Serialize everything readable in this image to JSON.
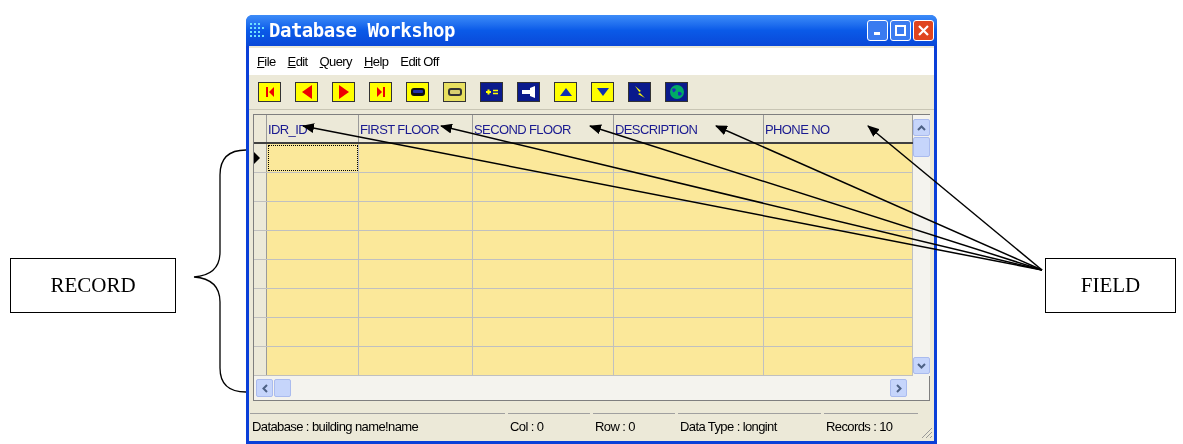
{
  "window": {
    "title": "Database Workshop"
  },
  "menu": [
    {
      "label": "File",
      "mnemonic": true
    },
    {
      "label": "Edit",
      "mnemonic": true
    },
    {
      "label": "Query",
      "mnemonic": true
    },
    {
      "label": "Help",
      "mnemonic": true
    },
    {
      "label": "Edit Off",
      "mnemonic": false
    }
  ],
  "toolbar": [
    {
      "kind": "first"
    },
    {
      "kind": "prev"
    },
    {
      "kind": "next"
    },
    {
      "kind": "last"
    },
    {
      "kind": "goggles-dark"
    },
    {
      "kind": "goggles-light"
    },
    {
      "kind": "calc"
    },
    {
      "kind": "torch"
    },
    {
      "kind": "up"
    },
    {
      "kind": "down"
    },
    {
      "kind": "bolt"
    },
    {
      "kind": "globe"
    }
  ],
  "grid": {
    "columns": [
      "IDR_ID",
      "FIRST FLOOR",
      "SECOND FLOOR",
      "DESCRIPTION",
      "PHONE NO"
    ],
    "rows": [
      {
        "current": true
      },
      {
        "current": false
      },
      {
        "current": false
      },
      {
        "current": false
      },
      {
        "current": false
      },
      {
        "current": false
      },
      {
        "current": false
      },
      {
        "current": false
      }
    ]
  },
  "status_bar": [
    "Database : building name!name",
    "Col : 0",
    "Row : 0",
    "Data Type : longint",
    "Records : 10"
  ],
  "annotations": {
    "record_label": "RECORD",
    "field_label": "FIELD"
  }
}
